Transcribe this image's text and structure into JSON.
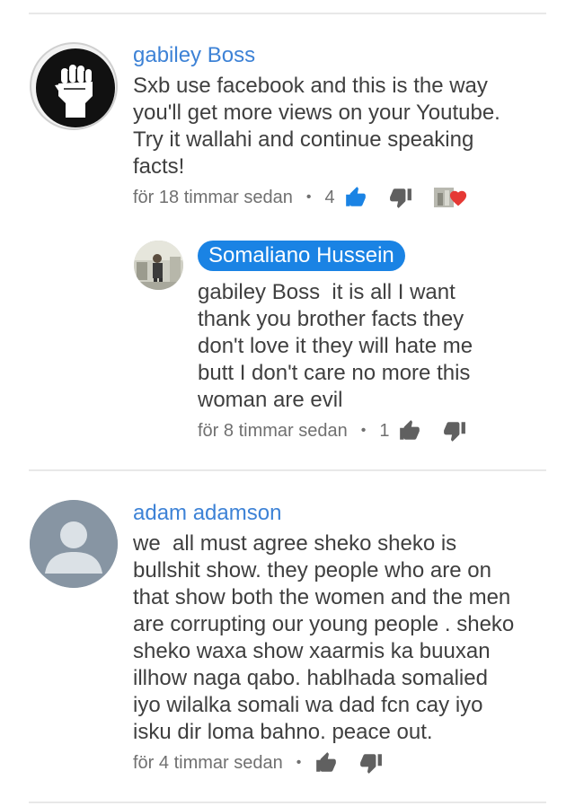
{
  "comments": [
    {
      "author": "gabiley Boss",
      "text_lines": [
        "Sxb use facebook and this is the way",
        "you'll get more views on your Youtube.",
        "Try it wallahi and continue speaking",
        "facts!"
      ],
      "timestamp": "för 18 timmar sedan",
      "likes": "4",
      "avatar_icon": "raised-fist-icon",
      "colors": {
        "author": "#3d82d6",
        "like_active": "#1a83e4",
        "heart": "#e53935"
      }
    },
    {
      "author": "Somaliano Hussein",
      "text_lines": [
        "gabiley Boss  it is all I want",
        "thank you brother facts they",
        "don't love it they will hate me",
        "butt I don't care no more this",
        "woman are evil"
      ],
      "timestamp": "för 8 timmar sedan",
      "likes": "1",
      "avatar_icon": "photo-avatar",
      "colors": {
        "author_chip": "#1a83e4"
      }
    },
    {
      "author": "adam adamson",
      "text_lines": [
        "we  all must agree sheko sheko is",
        "bullshit show. they people who are on",
        "that show both the women and the men",
        "are corrupting our young people . sheko",
        "sheko waxa show xaarmis ka buuxan",
        "illhow naga qabo. hablhada somalied",
        "iyo wilalka somali wa dad fcn cay iyo",
        "isku dir loma bahno. peace out."
      ],
      "timestamp": "för 4 timmar sedan",
      "avatar_icon": "default-user-icon"
    }
  ],
  "separator": "•"
}
